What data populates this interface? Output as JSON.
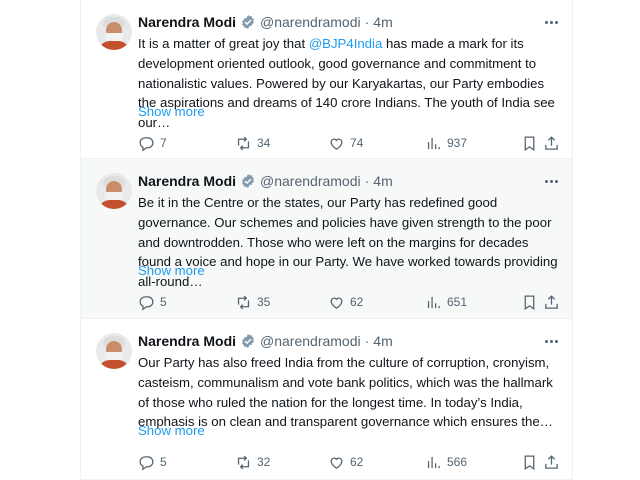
{
  "tweets": [
    {
      "name": "Narendra Modi",
      "handle": "@narendramodi",
      "separator": "·",
      "time": "4m",
      "text_before": "It is a matter of great joy that ",
      "mention": "@BJP4India",
      "text_after": " has made a mark for its development oriented outlook, good governance and commitment to nationalistic values. Powered by our Karyakartas, our Party embodies the aspirations and dreams of 140 crore Indians. The youth of India see our…",
      "show_more": "Show more",
      "replies": "7",
      "reposts": "34",
      "likes": "74",
      "views": "937"
    },
    {
      "name": "Narendra Modi",
      "handle": "@narendramodi",
      "separator": "·",
      "time": "4m",
      "text": "Be it in the Centre or the states, our Party has redefined good governance. Our schemes and policies have given strength to the poor and downtrodden. Those who were left on the margins for decades found a voice and hope in our Party. We have worked towards providing all-round…",
      "show_more": "Show more",
      "replies": "5",
      "reposts": "35",
      "likes": "62",
      "views": "651"
    },
    {
      "name": "Narendra Modi",
      "handle": "@narendramodi",
      "separator": "·",
      "time": "4m",
      "text": "Our Party has also freed India from the culture of corruption, cronyism, casteism, communalism and vote bank politics, which was the hallmark of those who ruled the nation for the longest time. In today’s India, emphasis is on clean and transparent governance which ensures the…",
      "show_more": "Show more",
      "replies": "5",
      "reposts": "32",
      "likes": "62",
      "views": "566"
    }
  ],
  "icons": {
    "verified": "verified-badge-icon",
    "more": "more-options-icon",
    "reply": "reply-icon",
    "repost": "repost-icon",
    "like": "like-icon",
    "views": "views-icon",
    "bookmark": "bookmark-icon",
    "share": "share-icon"
  },
  "colors": {
    "link": "#1d9bf0",
    "secondary_text": "#536471",
    "verified": "#829aab",
    "hover_background": "#f7f9f9"
  }
}
